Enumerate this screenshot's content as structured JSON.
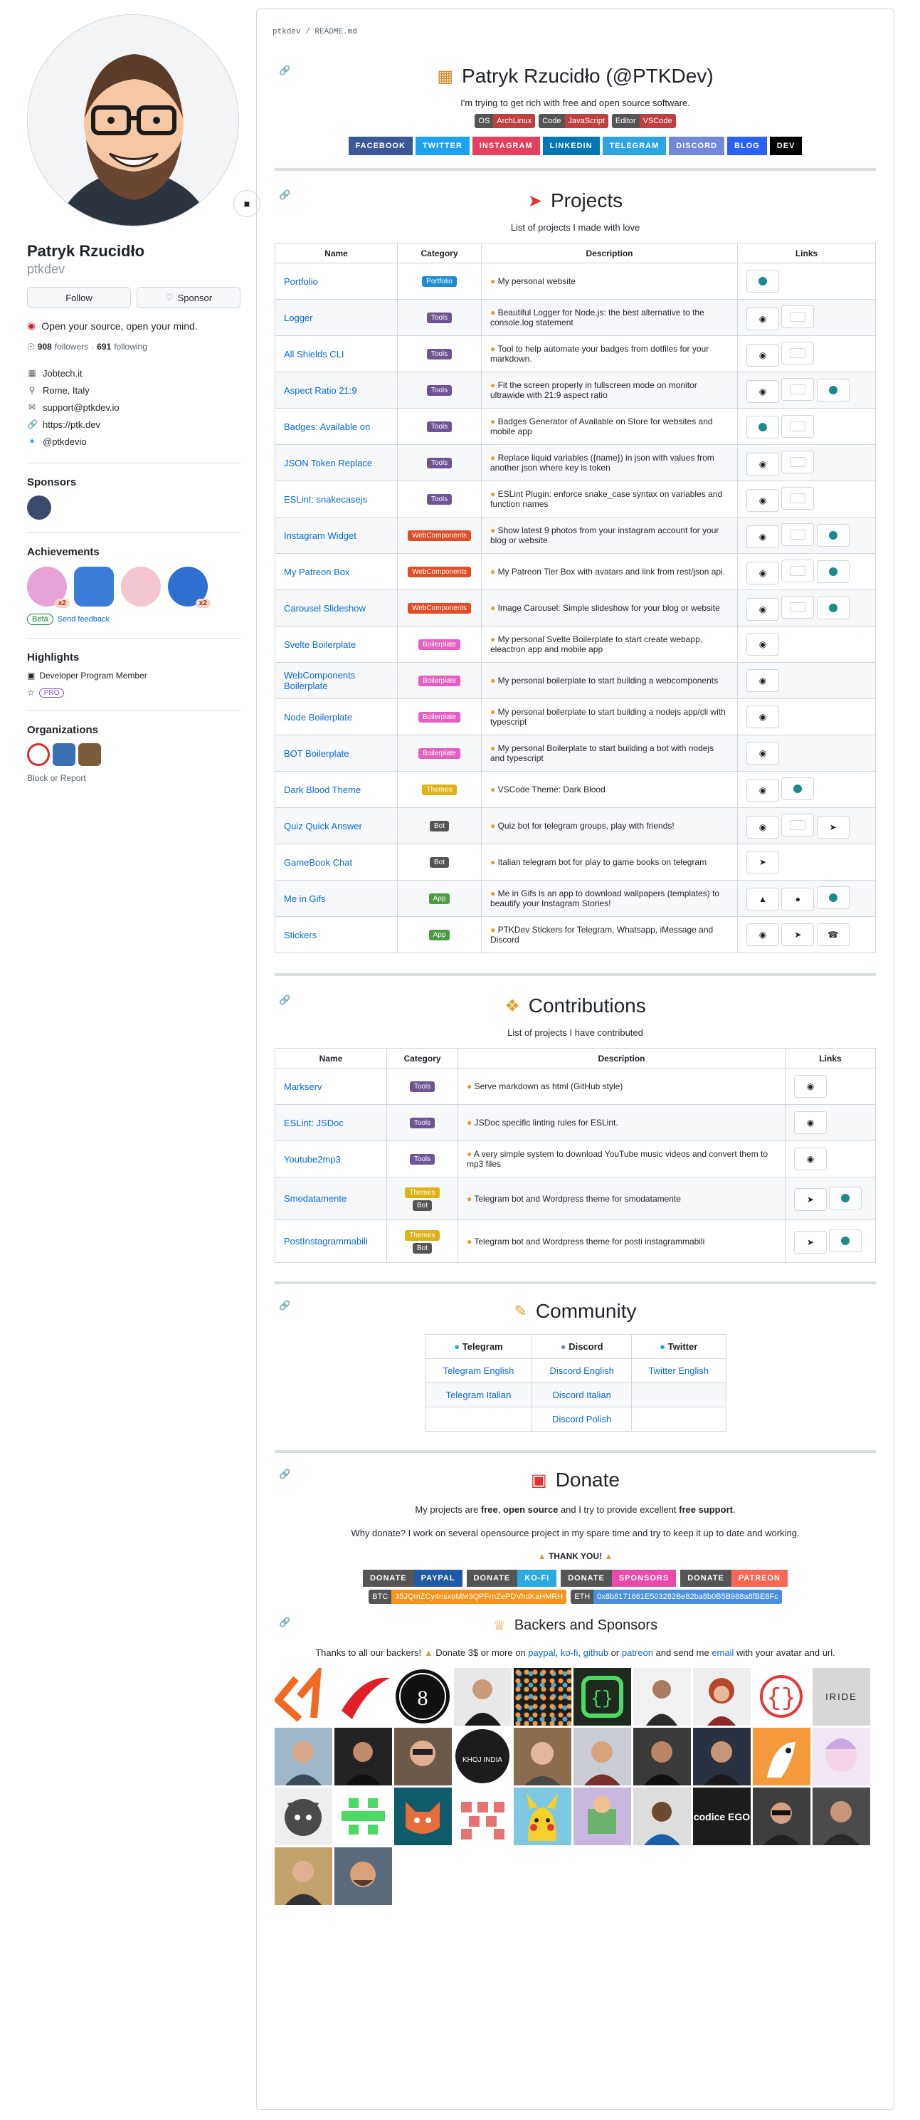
{
  "profile": {
    "fullname": "Patryk Rzucidło",
    "login": "ptkdev",
    "follow_label": "Follow",
    "sponsor_label": "Sponsor",
    "bio": "Open your source, open your mind.",
    "followers": "908",
    "followers_label": "followers",
    "following": "691",
    "following_label": "following",
    "company": "Jobtech.it",
    "location": "Rome, Italy",
    "email": "support@ptkdev.io",
    "website": "https://ptk.dev",
    "twitter": "@ptkdevio"
  },
  "sidebar": {
    "sponsors_title": "Sponsors",
    "achievements_title": "Achievements",
    "achievement_x2": "x2",
    "beta_label": "Beta",
    "feedback_label": "Send feedback",
    "highlights_title": "Highlights",
    "highlight_dev": "Developer Program Member",
    "highlight_pro": "PRO",
    "organizations_title": "Organizations",
    "block_report": "Block or Report"
  },
  "readme": {
    "path": "ptkdev / README.md",
    "title": "Patryk Rzucidło (@PTKDev)",
    "tagline": "I'm trying to get rich with free and open source software.",
    "shields": [
      {
        "label": "OS",
        "value": "ArchLinux"
      },
      {
        "label": "Code",
        "value": "JavaScript"
      },
      {
        "label": "Editor",
        "value": "VSCode"
      }
    ],
    "social": [
      "FACEBOOK",
      "TWITTER",
      "INSTAGRAM",
      "LINKEDIN",
      "TELEGRAM",
      "DISCORD",
      "BLOG",
      "DEV"
    ]
  },
  "projects": {
    "title": "Projects",
    "subtitle": "List of projects I made with love",
    "headers": [
      "Name",
      "Category",
      "Description",
      "Links"
    ],
    "rows": [
      {
        "name": "Portfolio",
        "cat": "Portfolio",
        "desc": "My personal website"
      },
      {
        "name": "Logger",
        "cat": "Tools",
        "desc": "Beautiful Logger for Node.js: the best alternative to the console.log statement"
      },
      {
        "name": "All Shields CLI",
        "cat": "Tools",
        "desc": "Tool to help automate your badges from dotfiles for your markdown."
      },
      {
        "name": "Aspect Ratio 21:9",
        "cat": "Tools",
        "desc": "Fit the screen properly in fullscreen mode on monitor ultrawide with 21:9 aspect ratio"
      },
      {
        "name": "Badges: Available on",
        "cat": "Tools",
        "desc": "Badges Generator of Available on Store for websites and mobile app"
      },
      {
        "name": "JSON Token Replace",
        "cat": "Tools",
        "desc": "Replace liquid variables ({name}) in json with values from another json where key is token"
      },
      {
        "name": "ESLint: snakecasejs",
        "cat": "Tools",
        "desc": "ESLint Plugin: enforce snake_case syntax on variables and function names"
      },
      {
        "name": "Instagram Widget",
        "cat": "WebComponents",
        "desc": "Show latest 9 photos from your instagram account for your blog or website"
      },
      {
        "name": "My Patreon Box",
        "cat": "WebComponents",
        "desc": "My Patreon Tier Box with avatars and link from rest/json api."
      },
      {
        "name": "Carousel Slideshow",
        "cat": "WebComponents",
        "desc": "Image Carousel: Simple slideshow for your blog or website"
      },
      {
        "name": "Svelte Boilerplate",
        "cat": "Boilerplate",
        "desc": "My personal Svelte Boilerplate to start create webapp, eleactron app and mobile app"
      },
      {
        "name": "WebComponents Boilerplate",
        "cat": "Boilerplate",
        "desc": "My personal boilerplate to start building a webcomponents"
      },
      {
        "name": "Node Boilerplate",
        "cat": "Boilerplate",
        "desc": "My personal boilerplate to start building a nodejs app/cli with typescript"
      },
      {
        "name": "BOT Boilerplate",
        "cat": "Boilerplate",
        "desc": "My personal Boilerplate to start building a bot with nodejs and typescript"
      },
      {
        "name": "Dark Blood Theme",
        "cat": "Themes",
        "desc": "VSCode Theme: Dark Blood"
      },
      {
        "name": "Quiz Quick Answer",
        "cat": "Bot",
        "desc": "Quiz bot for telegram groups, play with friends!"
      },
      {
        "name": "GameBook Chat",
        "cat": "Bot",
        "desc": "Italian telegram bot for play to game books on telegram"
      },
      {
        "name": "Me in Gifs",
        "cat": "App",
        "desc": "Me in Gifs is an app to download wallpapers (templates) to beautify your Instagram Stories!"
      },
      {
        "name": "Stickers",
        "cat": "App",
        "desc": "PTKDev Stickers for Telegram, Whatsapp, iMessage and Discord"
      }
    ]
  },
  "contributions": {
    "title": "Contributions",
    "subtitle": "List of projects I have contributed",
    "headers": [
      "Name",
      "Category",
      "Description",
      "Links"
    ],
    "rows": [
      {
        "name": "Markserv",
        "cat": "Tools",
        "desc": "Serve markdown as html (GitHub style)"
      },
      {
        "name": "ESLint: JSDoc",
        "cat": "Tools",
        "desc": "JSDoc specific linting rules for ESLint."
      },
      {
        "name": "Youtube2mp3",
        "cat": "Tools",
        "desc": "A very simple system to download YouTube music videos and convert them to mp3 files"
      },
      {
        "name": "Smodatamente",
        "cat": "Themes",
        "cat2": "Bot",
        "desc": "Telegram bot and Wordpress theme for smodatamente"
      },
      {
        "name": "PostInstagrammabili",
        "cat": "Themes",
        "cat2": "Bot",
        "desc": "Telegram bot and Wordpress theme for posti instagrammabili"
      }
    ]
  },
  "community": {
    "title": "Community",
    "headers": [
      "Telegram",
      "Discord",
      "Twitter"
    ],
    "rows": [
      [
        "Telegram English",
        "Discord English",
        "Twitter English"
      ],
      [
        "Telegram Italian",
        "Discord Italian",
        ""
      ],
      [
        "",
        "Discord Polish",
        ""
      ]
    ]
  },
  "donate": {
    "title": "Donate",
    "line1_pre": "My projects are ",
    "line1_free": "free",
    "line1_mid": ", ",
    "line1_os": "open source",
    "line1_mid2": " and I try to provide excellent ",
    "line1_support": "free support",
    "line1_end": ".",
    "line2": "Why donate? I work on several opensource project in my spare time and try to keep it up to date and working.",
    "thanks": "THANK YOU!",
    "buttons": [
      {
        "l": "DONATE",
        "r": "PAYPAL"
      },
      {
        "l": "DONATE",
        "r": "KO-FI"
      },
      {
        "l": "DONATE",
        "r": "SPONSORS"
      },
      {
        "l": "DONATE",
        "r": "PATREON"
      }
    ],
    "btc_label": "BTC",
    "btc_addr": "35JQmZCy4nsxoMM3QPFrnZePDVhdKaHMRH",
    "eth_label": "ETH",
    "eth_addr": "0x8b8171661E503282Be82ba8b0B5B988a8fBE8Fc"
  },
  "backers": {
    "title": "Backers and Sponsors",
    "text_pre": "Thanks to all our backers! ",
    "text_mid": " Donate 3$ or more on ",
    "paypal": "paypal",
    "kofi": "ko-fi",
    "github": "github",
    "or": " or ",
    "patreon": "patreon",
    "text_send": " and send me ",
    "email": "email",
    "text_end": " with your avatar and url.",
    "iride": "IRIDE",
    "codice": "codice EGO",
    "khoj": "KHOJ INDIA"
  },
  "colors": {
    "accent": "#0969da",
    "tools": "#6e5494",
    "portfolio": "#1f8dd6",
    "webcomponents": "#e34c26",
    "boilerplate": "#e45fc3",
    "themes": "#dfb317",
    "bot": "#555555",
    "app": "#4c9a41"
  }
}
